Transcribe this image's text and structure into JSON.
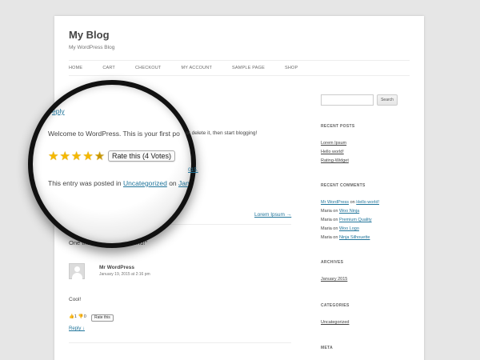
{
  "site": {
    "title": "My Blog",
    "description": "My WordPress Blog"
  },
  "nav": [
    "HOME",
    "CART",
    "CHECKOUT",
    "MY ACCOUNT",
    "SAMPLE PAGE",
    "SHOP"
  ],
  "post": {
    "welcome": "Welcome to WordPress. This is your first post. Edit or delete it, then start blogging!",
    "lens_welcome_a": "Welcome to WordPress. This is your first po",
    "lens_welcome_b": "or delete it, then start blogging!",
    "stars": 4.5,
    "rate_label": "Rate this (4 Votes)",
    "meta_prefix": "This entry was posted in ",
    "meta_category": "Uncategorized",
    "meta_on": " on ",
    "meta_date": "Janu",
    "meta_date_tail": "015.",
    "reply_fragment": "eply",
    "next_link": "Lorem Ipsum →"
  },
  "comments": {
    "heading": "One thought on “Hello world!”",
    "author": "Mr WordPress",
    "date": "January 19, 2015 at 2:16 pm",
    "text": "Cool!",
    "likes": "1",
    "dislikes": "0",
    "rate_small": "Rate this",
    "reply": "Reply ↓"
  },
  "sidebar": {
    "search_button": "Search",
    "search_placeholder": "",
    "recent_posts_title": "RECENT POSTS",
    "recent_posts": [
      "Lorem Ipsum",
      "Hello world!",
      "Rating-Widget"
    ],
    "recent_comments_title": "RECENT COMMENTS",
    "recent_comments": [
      {
        "author": "Mr WordPress",
        "on": " on ",
        "post": "Hello world!",
        "author_link": true
      },
      {
        "author": "Maria",
        "on": " on ",
        "post": "Woo Ninja",
        "author_link": false
      },
      {
        "author": "Maria",
        "on": " on ",
        "post": "Premium Quality",
        "author_link": false
      },
      {
        "author": "Maria",
        "on": " on ",
        "post": "Woo Logo",
        "author_link": false
      },
      {
        "author": "Maria",
        "on": " on ",
        "post": "Ninja Silhouette",
        "author_link": false
      }
    ],
    "archives_title": "ARCHIVES",
    "archives": [
      "January 2015"
    ],
    "categories_title": "CATEGORIES",
    "categories": [
      "Uncategorized"
    ],
    "meta_title": "META"
  },
  "colors": {
    "link": "#21759b",
    "star": "#f5b800",
    "background": "#e6e6e6"
  }
}
